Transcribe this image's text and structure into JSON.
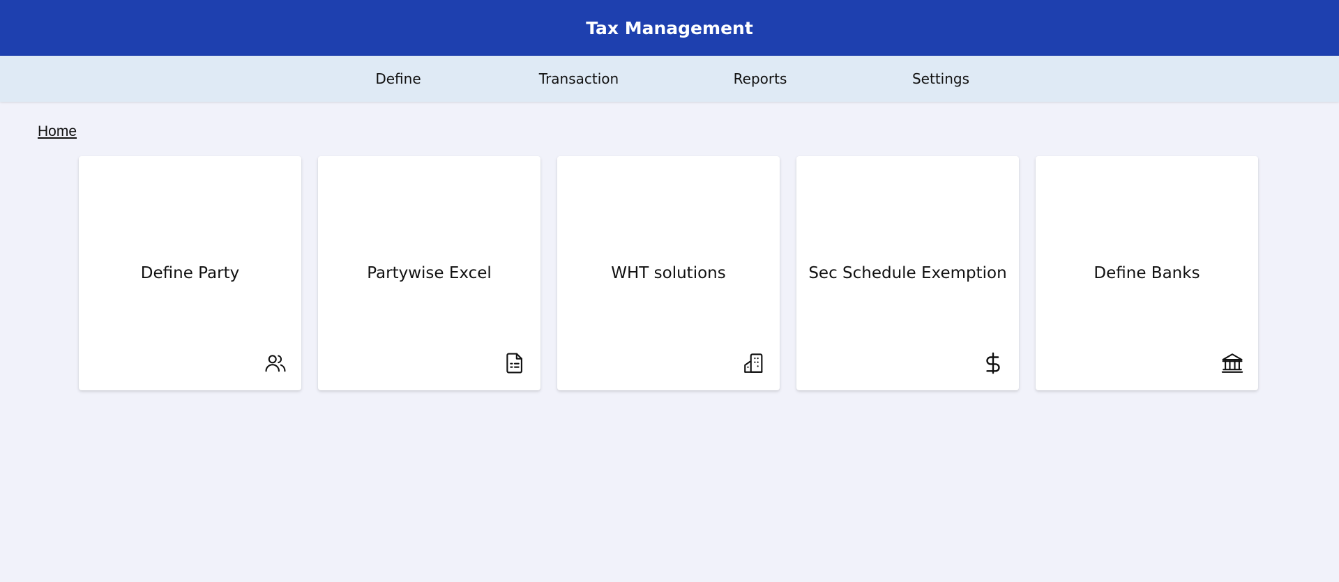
{
  "header": {
    "title": "Tax Management",
    "bg_color": "#1e40af"
  },
  "nav": {
    "bg_color": "#dfeaf5",
    "items": [
      {
        "label": "Define"
      },
      {
        "label": "Transaction"
      },
      {
        "label": "Reports"
      },
      {
        "label": "Settings"
      }
    ]
  },
  "breadcrumb": {
    "home": "Home"
  },
  "cards": [
    {
      "label": "Define Party",
      "icon": "users-icon"
    },
    {
      "label": "Partywise Excel",
      "icon": "document-spreadsheet-icon"
    },
    {
      "label": "WHT solutions",
      "icon": "building-icon"
    },
    {
      "label": "Sec Schedule Exemption",
      "icon": "dollar-icon"
    },
    {
      "label": "Define Banks",
      "icon": "bank-icon"
    }
  ],
  "colors": {
    "page_bg": "#f1f2fa",
    "card_bg": "#ffffff"
  }
}
